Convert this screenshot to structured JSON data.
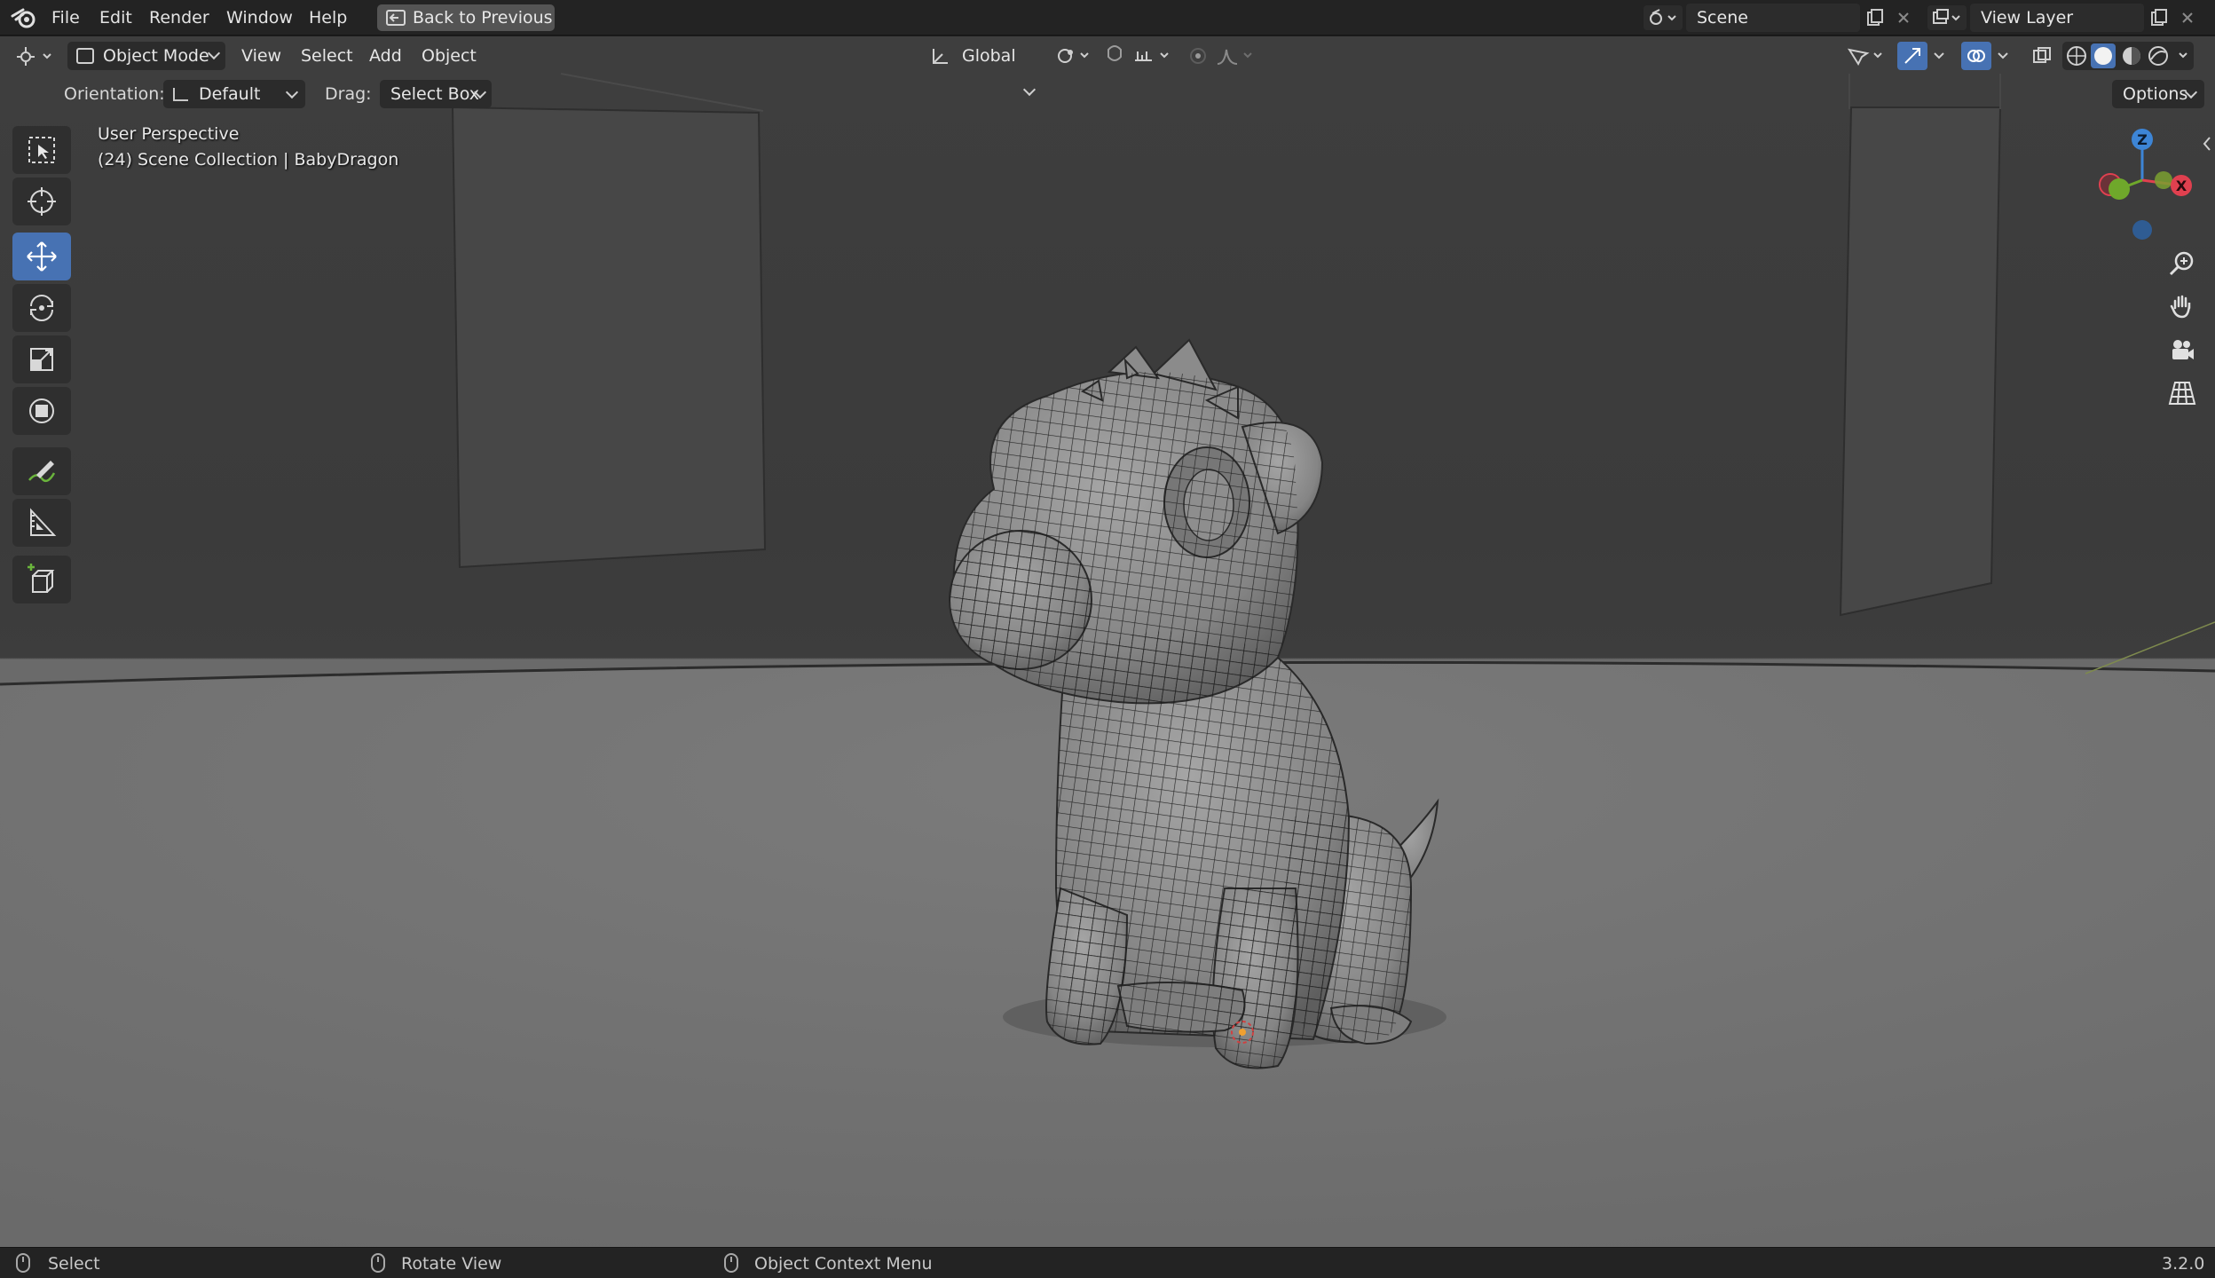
{
  "menu": {
    "items": [
      "File",
      "Edit",
      "Render",
      "Window",
      "Help"
    ],
    "back_button": "Back to Previous",
    "scene": "Scene",
    "view_layer": "View Layer"
  },
  "view_header": {
    "mode": "Object Mode",
    "menus": [
      "View",
      "Select",
      "Add",
      "Object"
    ],
    "transform_orientation": "Global"
  },
  "tool_settings": {
    "orientation_label": "Orientation:",
    "orientation_value": "Default",
    "drag_label": "Drag:",
    "drag_value": "Select Box",
    "options": "Options"
  },
  "overlay": {
    "perspective": "User Perspective",
    "collection": "(24) Scene Collection | BabyDragon"
  },
  "gizmo": {
    "z": "Z",
    "x": "X"
  },
  "statusbar": {
    "select": "Select",
    "rotate": "Rotate View",
    "context": "Object Context Menu",
    "version": "3.2.0"
  },
  "colors": {
    "accent": "#4772b3",
    "axis_x": "#e0404f",
    "axis_y": "#6fa82b",
    "axis_z": "#3d85d6"
  },
  "icons": [
    "blender-logo",
    "select-box-icon",
    "cursor-icon",
    "move-icon",
    "rotate-icon",
    "scale-icon",
    "transform-icon",
    "annotate-icon",
    "measure-icon",
    "add-cube-icon",
    "zoom-icon",
    "hand-icon",
    "camera-icon",
    "grid-icon"
  ]
}
